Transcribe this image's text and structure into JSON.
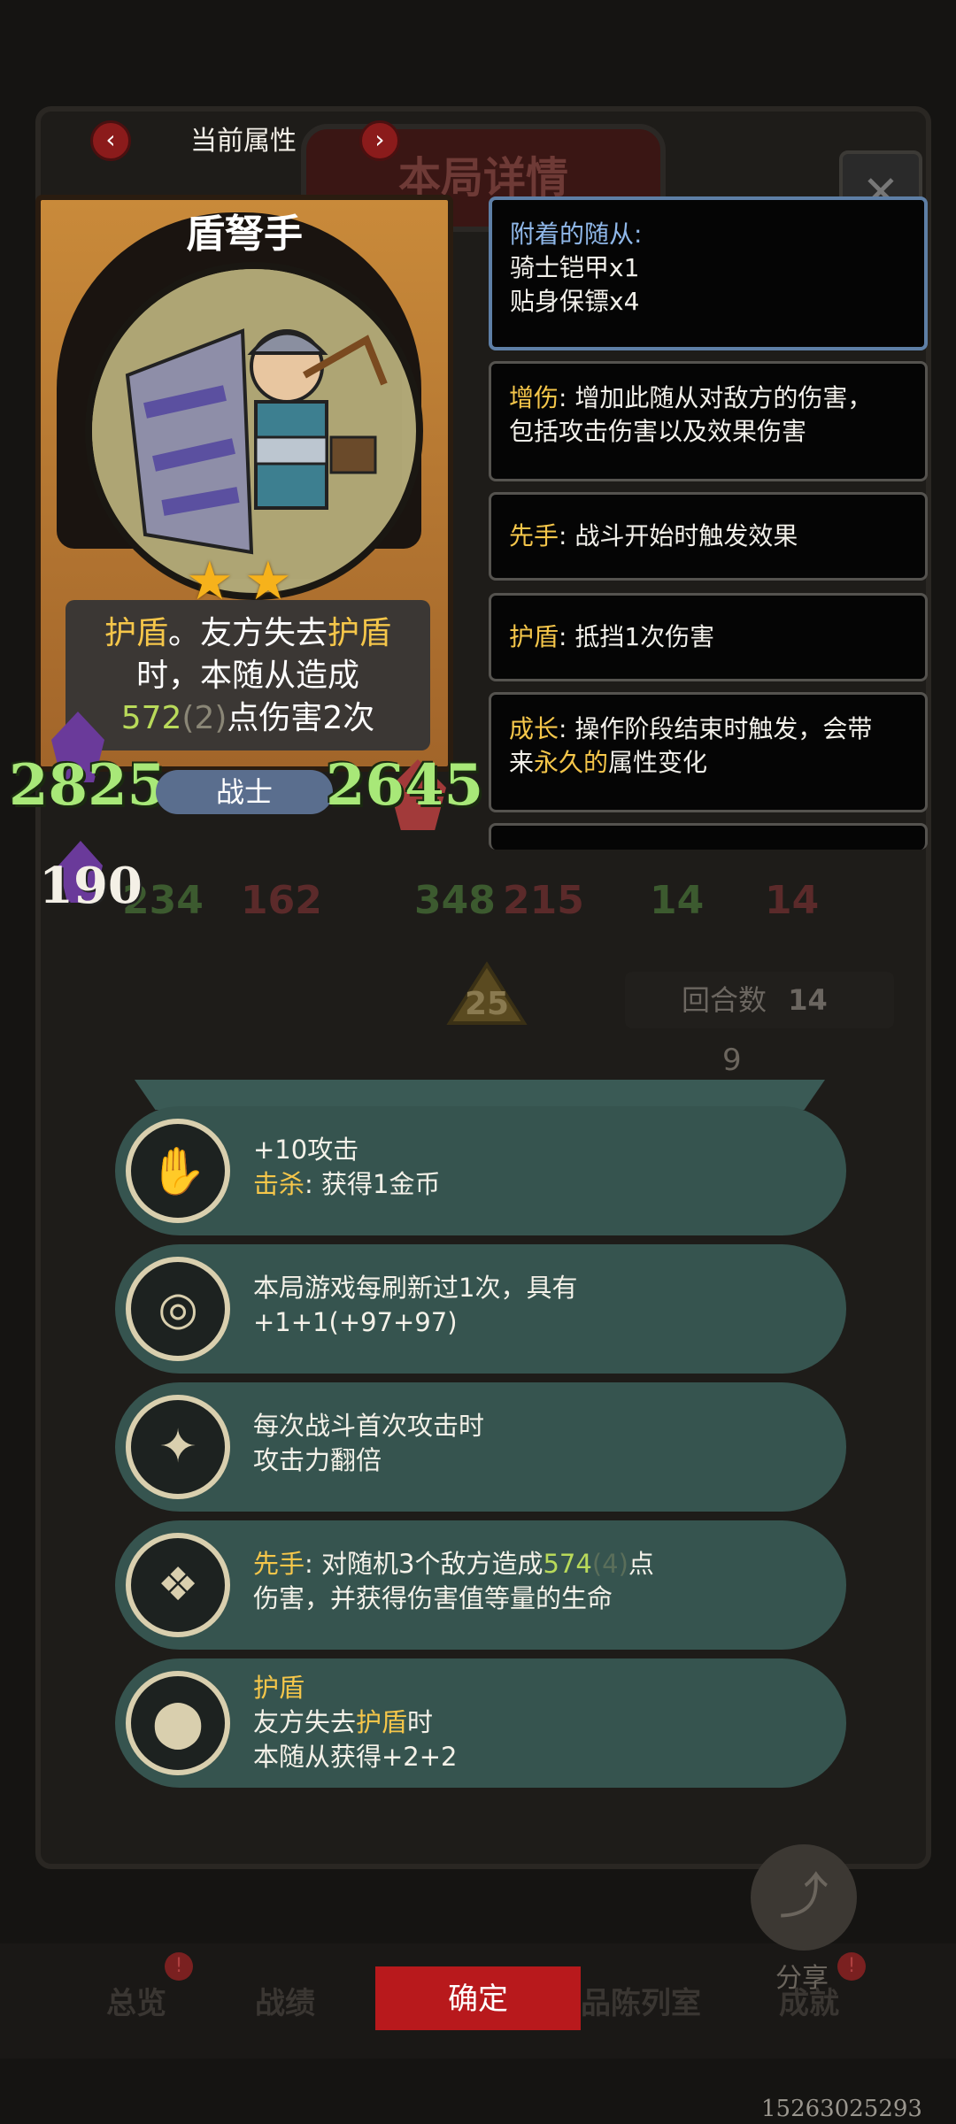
{
  "nav": {
    "prev_icon": "chevron-left-icon",
    "next_icon": "chevron-right-icon",
    "title": "当前属性"
  },
  "background": {
    "title": "本局详情",
    "board_stats": [
      "234",
      "162",
      "348",
      "215",
      "14",
      "14"
    ],
    "level": "25",
    "round_label": "回合数",
    "round_value": "14",
    "shop_level": "9"
  },
  "card": {
    "name": "盾弩手",
    "stars": 2,
    "desc_line1_a": "护盾",
    "desc_line1_b": "。友方失去",
    "desc_line1_c": "护盾",
    "desc_line2": "时，本随从造成",
    "desc_line3_value": "572",
    "desc_line3_paren": "(2)",
    "desc_line3_rest": "点伤害2次",
    "attack": "2825",
    "health": "2645",
    "class": "战士",
    "extra_stat": "190"
  },
  "keywords": {
    "attached_title": "附着的随从:",
    "attached_items": [
      "骑士铠甲x1",
      "贴身保镖x4"
    ],
    "items": [
      {
        "key": "增伤",
        "text": ": 增加此随从对敌方的伤害，",
        "text2": "包括攻击伤害以及效果伤害"
      },
      {
        "key": "先手",
        "text": ": 战斗开始时触发效果"
      },
      {
        "key": "护盾",
        "text": ": 抵挡1次伤害"
      },
      {
        "key": "成长",
        "text": ": 操作阶段结束时触发，会带",
        "text2_a": "来",
        "text2_b": "永久的",
        "text2_c": "属性变化"
      }
    ]
  },
  "abilities": [
    {
      "icon": "gauntlet-icon",
      "line1": "+10攻击",
      "line2_key": "击杀",
      "line2_rest": ": 获得1金币"
    },
    {
      "icon": "ring-icon",
      "line1": "本局游戏每刷新过1次，具有",
      "line2": "+1+1(+97+97)"
    },
    {
      "icon": "beast-icon",
      "line1": "每次战斗首次攻击时",
      "line2": "攻击力翻倍"
    },
    {
      "icon": "bird-icon",
      "line1_key": "先手",
      "line1_a": ": 对随机3个敌方造成",
      "line1_num": "574",
      "line1_dim": "(4)",
      "line1_b": "点",
      "line2": "伤害，并获得伤害值等量的生命"
    },
    {
      "icon": "shield-orb-icon",
      "line1_key": "护盾",
      "line2_a": "友方失去",
      "line2_key": "护盾",
      "line2_b": "时",
      "line3": "本随从获得+2+2"
    }
  ],
  "bottom": {
    "tabs": [
      "总览",
      "战绩",
      "品陈列室",
      "成就"
    ],
    "confirm": "确定",
    "share_label": "分享",
    "share_icon": "share-icon",
    "user_id": "15263025293"
  },
  "colors": {
    "accent_red": "#b8191c",
    "keyword_yellow": "#f5c64a",
    "value_green": "#b9da5a",
    "ability_bg": "#36544f"
  }
}
